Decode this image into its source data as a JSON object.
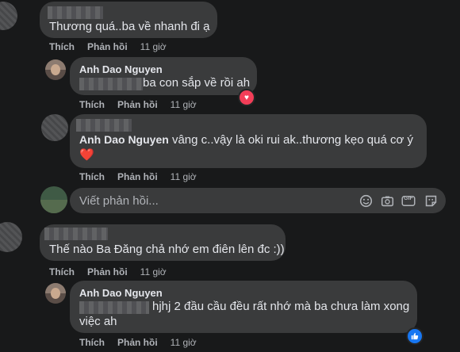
{
  "comments": [
    {
      "text": "Thương quá..ba về nhanh đi ạ",
      "actions": {
        "like": "Thích",
        "reply": "Phản hồi",
        "time": "11 giờ"
      },
      "replies": [
        {
          "author": "Anh Dao Nguyen",
          "text": "ba con sắp về rồi ah",
          "reaction": "heart-icon",
          "actions": {
            "like": "Thích",
            "reply": "Phản hồi",
            "time": "11 giờ"
          }
        },
        {
          "author": "Anh Dao Nguyen",
          "text": "vâng c..vậy là oki rui ak..thương kẹo quá cơ ý",
          "emoji": "❤️",
          "actions": {
            "like": "Thích",
            "reply": "Phản hồi",
            "time": "11 giờ"
          }
        }
      ]
    },
    {
      "text": "Thế nào Ba Đăng chả nhớ em điên lên đc :))",
      "actions": {
        "like": "Thích",
        "reply": "Phản hồi",
        "time": "11 giờ"
      },
      "replies": [
        {
          "author": "Anh Dao Nguyen",
          "text_line1": "hjhj 2 đầu cầu đều rất nhớ mà ba chưa làm xong",
          "text_line2": "việc ah",
          "reaction": "like-icon",
          "actions": {
            "like": "Thích",
            "reply": "Phản hồi",
            "time": "11 giờ"
          }
        }
      ]
    }
  ],
  "reply_box": {
    "placeholder": "Viết phản hồi...",
    "tools": [
      "emoji-icon",
      "camera-icon",
      "gif-icon",
      "sticker-icon"
    ],
    "gif_label": "GIF"
  },
  "colors": {
    "background": "#18191a",
    "bubble": "#3a3b3c",
    "heart": "#f33e58",
    "like": "#1877f2"
  }
}
